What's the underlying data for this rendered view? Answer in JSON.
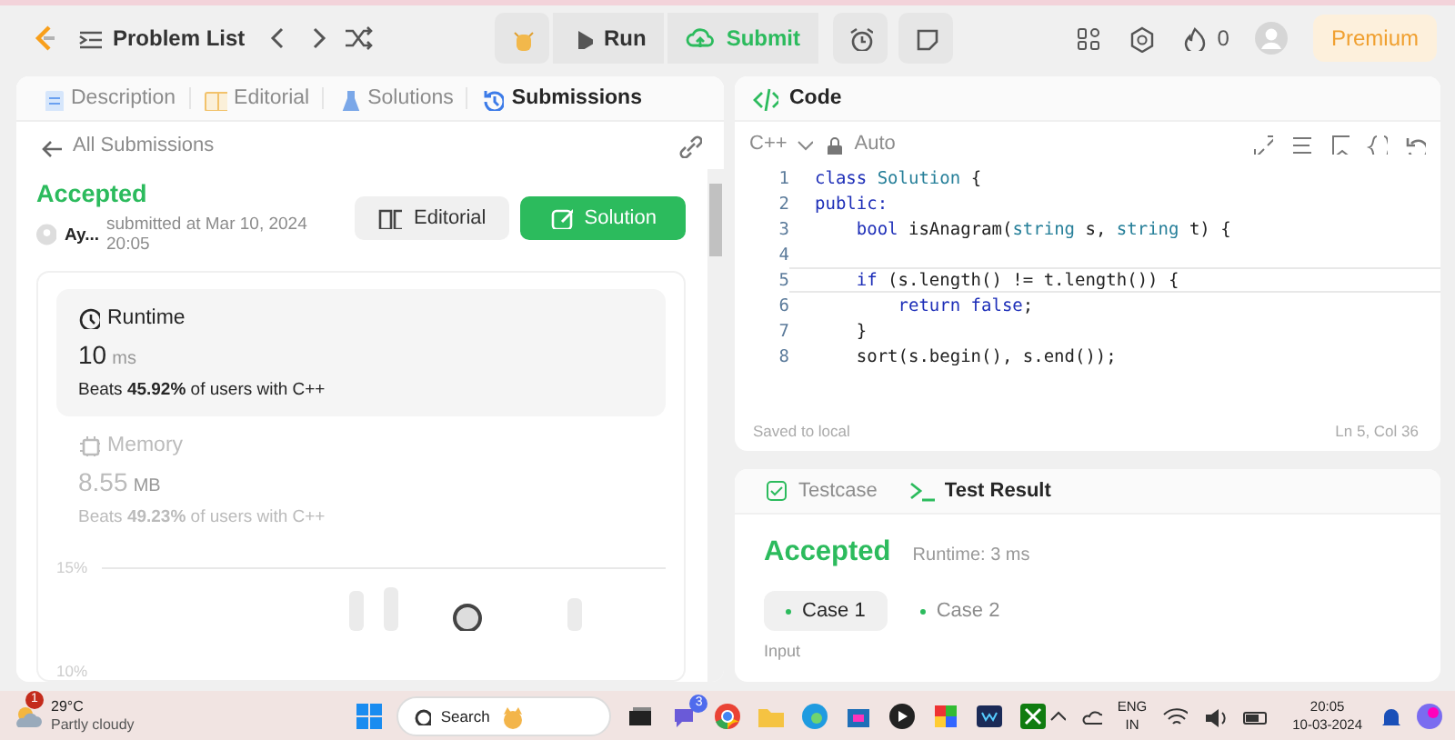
{
  "nav": {
    "problem_list": "Problem List",
    "run": "Run",
    "submit": "Submit",
    "streak": "0",
    "premium": "Premium"
  },
  "left_tabs": [
    {
      "label": "Description",
      "selected": false
    },
    {
      "label": "Editorial",
      "selected": false
    },
    {
      "label": "Solutions",
      "selected": false
    },
    {
      "label": "Submissions",
      "selected": true
    }
  ],
  "submission": {
    "back": "All Submissions",
    "status": "Accepted",
    "user": "Ay...",
    "submitted": "submitted at Mar 10, 2024 20:05",
    "editorial_button": "Editorial",
    "solution_button": "Solution"
  },
  "stats": [
    {
      "kind": "runtime",
      "title": "Runtime",
      "value": "10",
      "unit": "ms",
      "beats": "Beats **45.92%** of users with C++",
      "selected": true
    },
    {
      "kind": "memory",
      "title": "Memory",
      "value": "8.55",
      "unit": "MB",
      "beats": "Beats **49.23%** of users with C++",
      "selected": false
    }
  ],
  "distribution": {
    "ticks": [
      "15%",
      "10%"
    ]
  },
  "code": {
    "title": "Code",
    "language": "C++",
    "mode": "Auto",
    "saved": "Saved to local",
    "cursor": "Ln 5, Col 36",
    "lines": [
      {
        "number": "1",
        "current": false,
        "tokens": [
          {
            "kind": "kw",
            "text": "class "
          },
          {
            "kind": "type",
            "text": "Solution"
          },
          {
            "kind": "plain",
            "text": " {"
          }
        ]
      },
      {
        "number": "2",
        "current": false,
        "tokens": [
          {
            "kind": "kw",
            "text": "public:"
          }
        ]
      },
      {
        "number": "3",
        "current": false,
        "tokens": [
          {
            "kind": "kw",
            "text": "    bool "
          },
          {
            "kind": "plain",
            "text": "isAnagram("
          },
          {
            "kind": "type",
            "text": "string"
          },
          {
            "kind": "plain",
            "text": " s, "
          },
          {
            "kind": "type",
            "text": "string"
          },
          {
            "kind": "plain",
            "text": " t) {"
          }
        ]
      },
      {
        "number": "4",
        "current": false
      },
      {
        "number": "5",
        "current": true,
        "tokens": [
          {
            "kind": "kw",
            "text": "    if"
          },
          {
            "kind": "plain",
            "text": " (s.length() != t.length()) {"
          }
        ]
      },
      {
        "number": "6",
        "current": false,
        "tokens": [
          {
            "kind": "kw",
            "text": "        return false"
          },
          {
            "kind": "plain",
            "text": ";"
          }
        ]
      },
      {
        "number": "7",
        "current": false,
        "tokens": [
          {
            "kind": "plain",
            "text": "    }"
          }
        ]
      },
      {
        "number": "8",
        "current": false,
        "tokens": [
          {
            "kind": "plain",
            "text": "    sort(s.begin(), s.end());"
          }
        ]
      }
    ]
  },
  "result_tabs": [
    {
      "label": "Testcase",
      "selected": false
    },
    {
      "label": "Test Result",
      "selected": true
    }
  ],
  "result": {
    "status": "Accepted",
    "runtime": "Runtime: 3 ms",
    "cases": [
      {
        "label": "Case 1",
        "selected": true
      },
      {
        "label": "Case 2",
        "selected": false
      }
    ],
    "input_label": "Input"
  },
  "taskbar": {
    "temperature": "29°C",
    "weather": "Partly cloudy",
    "weather_badge": "1",
    "search": "Search",
    "chat_badge": "3",
    "language": "ENG",
    "region": "IN",
    "time": "20:05",
    "date": "10-03-2024"
  }
}
